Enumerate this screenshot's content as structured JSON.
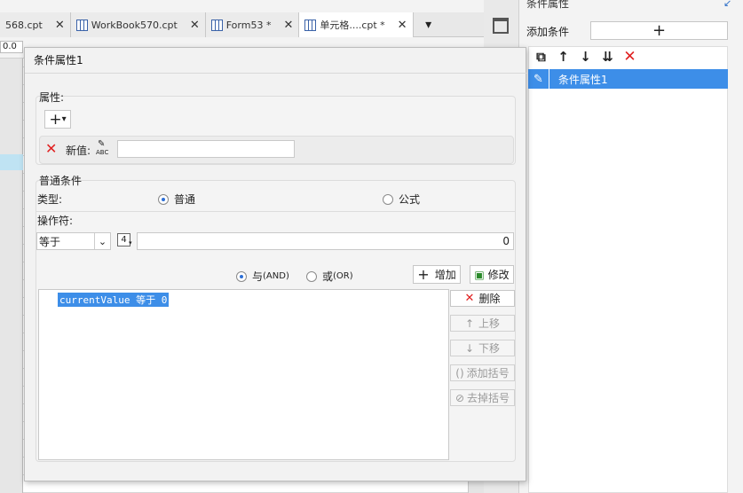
{
  "tabs": [
    {
      "label": "568.cpt",
      "active": false
    },
    {
      "label": "WorkBook570.cpt",
      "active": false
    },
    {
      "label": "Form53 *",
      "active": false
    },
    {
      "label": "单元格....cpt *",
      "active": true
    }
  ],
  "cell_ref": "0.0",
  "right_panel": {
    "title": "条件属性",
    "add_condition_label": "添加条件",
    "add_button": "+",
    "items": [
      {
        "label": "条件属性1"
      }
    ]
  },
  "dialog": {
    "title": "条件属性1",
    "attr_group_label": "属性:",
    "attr_add_button": "+",
    "new_value_label": "新值:",
    "new_value_icon_text": "ABC",
    "new_value": "",
    "general_group_label": "普通条件",
    "type_label": "类型:",
    "type_options": [
      {
        "label": "普通",
        "selected": true
      },
      {
        "label": "公式",
        "selected": false
      }
    ],
    "operator_label": "操作符:",
    "operator_value": "等于",
    "value_type_badge": "4",
    "operand_value": "0",
    "logic_options": [
      {
        "label": "与",
        "suffix": "(AND)",
        "selected": true
      },
      {
        "label": "或",
        "suffix": "(OR)",
        "selected": false
      }
    ],
    "add_label": "增加",
    "modify_label": "修改",
    "condition_text": "currentValue 等于 0",
    "side_buttons": [
      {
        "label": "删除",
        "enabled": true
      },
      {
        "label": "上移",
        "enabled": false
      },
      {
        "label": "下移",
        "enabled": false
      },
      {
        "label": "添加括号",
        "enabled": false
      },
      {
        "label": "去掉括号",
        "enabled": false
      }
    ]
  },
  "colors": {
    "accent_blue": "#3d8ee8",
    "delete_red": "#e02020",
    "selection_blue": "#3d8ee8"
  }
}
